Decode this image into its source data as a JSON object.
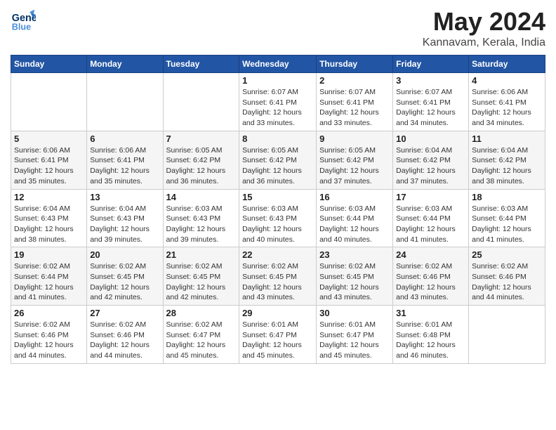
{
  "header": {
    "logo_line1": "General",
    "logo_line2": "Blue",
    "month": "May 2024",
    "location": "Kannavam, Kerala, India"
  },
  "weekdays": [
    "Sunday",
    "Monday",
    "Tuesday",
    "Wednesday",
    "Thursday",
    "Friday",
    "Saturday"
  ],
  "weeks": [
    [
      {
        "day": "",
        "info": ""
      },
      {
        "day": "",
        "info": ""
      },
      {
        "day": "",
        "info": ""
      },
      {
        "day": "1",
        "info": "Sunrise: 6:07 AM\nSunset: 6:41 PM\nDaylight: 12 hours\nand 33 minutes."
      },
      {
        "day": "2",
        "info": "Sunrise: 6:07 AM\nSunset: 6:41 PM\nDaylight: 12 hours\nand 33 minutes."
      },
      {
        "day": "3",
        "info": "Sunrise: 6:07 AM\nSunset: 6:41 PM\nDaylight: 12 hours\nand 34 minutes."
      },
      {
        "day": "4",
        "info": "Sunrise: 6:06 AM\nSunset: 6:41 PM\nDaylight: 12 hours\nand 34 minutes."
      }
    ],
    [
      {
        "day": "5",
        "info": "Sunrise: 6:06 AM\nSunset: 6:41 PM\nDaylight: 12 hours\nand 35 minutes."
      },
      {
        "day": "6",
        "info": "Sunrise: 6:06 AM\nSunset: 6:41 PM\nDaylight: 12 hours\nand 35 minutes."
      },
      {
        "day": "7",
        "info": "Sunrise: 6:05 AM\nSunset: 6:42 PM\nDaylight: 12 hours\nand 36 minutes."
      },
      {
        "day": "8",
        "info": "Sunrise: 6:05 AM\nSunset: 6:42 PM\nDaylight: 12 hours\nand 36 minutes."
      },
      {
        "day": "9",
        "info": "Sunrise: 6:05 AM\nSunset: 6:42 PM\nDaylight: 12 hours\nand 37 minutes."
      },
      {
        "day": "10",
        "info": "Sunrise: 6:04 AM\nSunset: 6:42 PM\nDaylight: 12 hours\nand 37 minutes."
      },
      {
        "day": "11",
        "info": "Sunrise: 6:04 AM\nSunset: 6:42 PM\nDaylight: 12 hours\nand 38 minutes."
      }
    ],
    [
      {
        "day": "12",
        "info": "Sunrise: 6:04 AM\nSunset: 6:43 PM\nDaylight: 12 hours\nand 38 minutes."
      },
      {
        "day": "13",
        "info": "Sunrise: 6:04 AM\nSunset: 6:43 PM\nDaylight: 12 hours\nand 39 minutes."
      },
      {
        "day": "14",
        "info": "Sunrise: 6:03 AM\nSunset: 6:43 PM\nDaylight: 12 hours\nand 39 minutes."
      },
      {
        "day": "15",
        "info": "Sunrise: 6:03 AM\nSunset: 6:43 PM\nDaylight: 12 hours\nand 40 minutes."
      },
      {
        "day": "16",
        "info": "Sunrise: 6:03 AM\nSunset: 6:44 PM\nDaylight: 12 hours\nand 40 minutes."
      },
      {
        "day": "17",
        "info": "Sunrise: 6:03 AM\nSunset: 6:44 PM\nDaylight: 12 hours\nand 41 minutes."
      },
      {
        "day": "18",
        "info": "Sunrise: 6:03 AM\nSunset: 6:44 PM\nDaylight: 12 hours\nand 41 minutes."
      }
    ],
    [
      {
        "day": "19",
        "info": "Sunrise: 6:02 AM\nSunset: 6:44 PM\nDaylight: 12 hours\nand 41 minutes."
      },
      {
        "day": "20",
        "info": "Sunrise: 6:02 AM\nSunset: 6:45 PM\nDaylight: 12 hours\nand 42 minutes."
      },
      {
        "day": "21",
        "info": "Sunrise: 6:02 AM\nSunset: 6:45 PM\nDaylight: 12 hours\nand 42 minutes."
      },
      {
        "day": "22",
        "info": "Sunrise: 6:02 AM\nSunset: 6:45 PM\nDaylight: 12 hours\nand 43 minutes."
      },
      {
        "day": "23",
        "info": "Sunrise: 6:02 AM\nSunset: 6:45 PM\nDaylight: 12 hours\nand 43 minutes."
      },
      {
        "day": "24",
        "info": "Sunrise: 6:02 AM\nSunset: 6:46 PM\nDaylight: 12 hours\nand 43 minutes."
      },
      {
        "day": "25",
        "info": "Sunrise: 6:02 AM\nSunset: 6:46 PM\nDaylight: 12 hours\nand 44 minutes."
      }
    ],
    [
      {
        "day": "26",
        "info": "Sunrise: 6:02 AM\nSunset: 6:46 PM\nDaylight: 12 hours\nand 44 minutes."
      },
      {
        "day": "27",
        "info": "Sunrise: 6:02 AM\nSunset: 6:46 PM\nDaylight: 12 hours\nand 44 minutes."
      },
      {
        "day": "28",
        "info": "Sunrise: 6:02 AM\nSunset: 6:47 PM\nDaylight: 12 hours\nand 45 minutes."
      },
      {
        "day": "29",
        "info": "Sunrise: 6:01 AM\nSunset: 6:47 PM\nDaylight: 12 hours\nand 45 minutes."
      },
      {
        "day": "30",
        "info": "Sunrise: 6:01 AM\nSunset: 6:47 PM\nDaylight: 12 hours\nand 45 minutes."
      },
      {
        "day": "31",
        "info": "Sunrise: 6:01 AM\nSunset: 6:48 PM\nDaylight: 12 hours\nand 46 minutes."
      },
      {
        "day": "",
        "info": ""
      }
    ]
  ]
}
